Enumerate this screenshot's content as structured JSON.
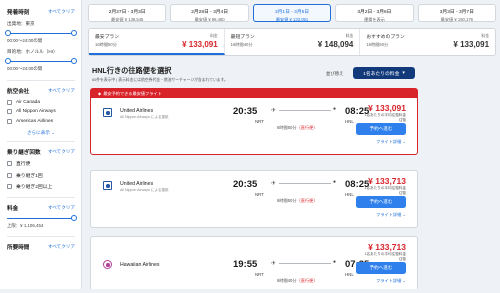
{
  "sidebar": {
    "departure": {
      "title": "発着時刻",
      "clear": "すべてクリア",
      "depart_label": "出発地：東京",
      "depart_range": "00:00〜24:00の間",
      "arrive_label": "目的地：ホノルル（HI）",
      "arrive_range": "00:00〜24:00の間"
    },
    "airlines": {
      "title": "航空会社",
      "clear": "すべてクリア",
      "items": [
        "Air Canada",
        "All Nippon Airways",
        "American Airlines"
      ],
      "more": "さらに表示"
    },
    "stops": {
      "title": "乗り継ぎ回数",
      "clear": "すべてクリア",
      "items": [
        "直行便",
        "乗り継ぎ1回",
        "乗り継ぎ2回以上"
      ]
    },
    "price": {
      "title": "料金",
      "clear": "すべてクリア",
      "max": "上限：¥ 1,106,454"
    },
    "duration": {
      "title": "所要時間",
      "clear": "すべてクリア"
    }
  },
  "date_tabs": [
    {
      "dates": "2月27日 - 3月3日",
      "price": "最安値 ¥ 139,545",
      "active": false
    },
    {
      "dates": "2月28日 - 3月4日",
      "price": "最安値 ¥ 98,480",
      "active": false
    },
    {
      "dates": "3月1日 - 3月5日",
      "price": "最安値 ¥ 133,091",
      "active": true
    },
    {
      "dates": "3月2日 - 3月6日",
      "price": "運賃を表示",
      "active": false
    },
    {
      "dates": "3月3日 - 3月7日",
      "price": "最安値 ¥ 150,176",
      "active": false
    }
  ],
  "sort_tabs": [
    {
      "title": "最安プラン",
      "duration": "16時間50分",
      "rate_label": "料金",
      "price": "¥ 133,091",
      "active": true
    },
    {
      "title": "最短プラン",
      "duration": "16時間40分",
      "rate_label": "料金",
      "price": "¥ 148,094",
      "active": false
    },
    {
      "title": "おすすめのプラン",
      "duration": "16時間50分",
      "rate_label": "料金",
      "price": "¥ 133,091",
      "active": false
    }
  ],
  "results_header": {
    "title": "HNL行きの往路便を選択",
    "note": "60件を表示中 | 表示料金には航空券代金・燃油サーチャージが含まれています。",
    "sort_label": "並び替え",
    "sort_value": "1名あたりの料金"
  },
  "flights": [
    {
      "badge": "最安予約できる最安値フライト",
      "airline": "United Airlines",
      "operated": "All Nippon Airways による運航",
      "dep_time": "20:35",
      "dep_airport": "NRT",
      "arr_time": "08:25",
      "arr_airport": "HNL",
      "duration": "6時間50分",
      "nonstop": "（直行便）",
      "price": "¥ 133,091",
      "per_person": "1名あたりの平均往復料金",
      "round_trip": "往復",
      "select": "予約へ進む",
      "details": "フライト詳細"
    },
    {
      "airline": "United Airlines",
      "operated": "All Nippon Airways による運航",
      "dep_time": "20:35",
      "dep_airport": "NRT",
      "arr_time": "08:25",
      "arr_airport": "HNL",
      "duration": "6時間50分",
      "nonstop": "（直行便）",
      "price": "¥ 133,713",
      "per_person": "1名あたりの平均往復料金",
      "round_trip": "往復",
      "select": "予約へ進む",
      "details": "フライト詳細"
    },
    {
      "airline": "Hawaiian Airlines",
      "operated": "",
      "dep_time": "19:55",
      "dep_airport": "NRT",
      "arr_time": "07:35",
      "arr_airport": "HNL",
      "duration": "6時間40分",
      "nonstop": "（直行便）",
      "price": "¥ 133,713",
      "per_person": "1名あたりの平均往復料金",
      "round_trip": "往復",
      "select": "予約へ進む",
      "details": "フライト詳細"
    }
  ],
  "colors": {
    "accent": "#1e6fd9",
    "price_red": "#d8232a",
    "button": "#2f80ed",
    "dark_navy": "#123a7a"
  }
}
